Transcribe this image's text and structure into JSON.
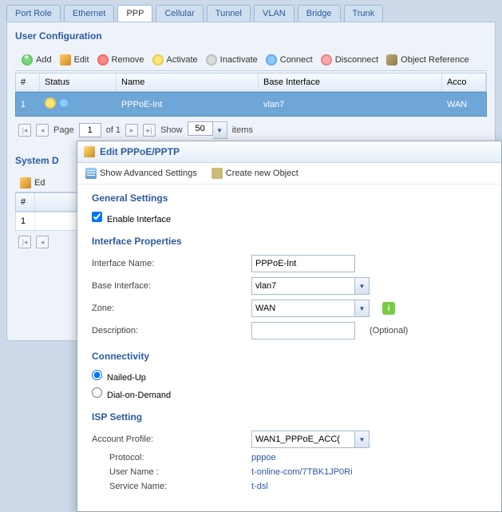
{
  "tabs": [
    "Port Role",
    "Ethernet",
    "PPP",
    "Cellular",
    "Tunnel",
    "VLAN",
    "Bridge",
    "Trunk"
  ],
  "active_tab": 2,
  "user_cfg_title": "User Configuration",
  "toolbar": {
    "add": "Add",
    "edit": "Edit",
    "remove": "Remove",
    "activate": "Activate",
    "inactivate": "Inactivate",
    "connect": "Connect",
    "disconnect": "Disconnect",
    "objref": "Object Reference"
  },
  "columns": {
    "num": "#",
    "status": "Status",
    "name": "Name",
    "base": "Base Interface",
    "acct": "Acco"
  },
  "row": {
    "num": "1",
    "name": "PPPoE-Int",
    "base": "vlan7",
    "acct": "WAN"
  },
  "pager": {
    "page_lbl": "Page",
    "page": "1",
    "of_lbl": "of 1",
    "show_lbl": "Show",
    "show": "50",
    "items_lbl": "items"
  },
  "sysd_title": "System D",
  "sysd_ed": "Ed",
  "sysd_num": "#",
  "sysd_row1": "1",
  "modal": {
    "title": "Edit PPPoE/PPTP",
    "adv": "Show Advanced Settings",
    "newobj": "Create new Object",
    "gen": "General Settings",
    "enable": "Enable Interface",
    "iprop": "Interface Properties",
    "ifname_lbl": "Interface Name:",
    "ifname": "PPPoE-Int",
    "baseif_lbl": "Base Interface:",
    "baseif": "vlan7",
    "zone_lbl": "Zone:",
    "zone": "WAN",
    "desc_lbl": "Description:",
    "desc": "",
    "optional": "(Optional)",
    "conn": "Connectivity",
    "nailed": "Nailed-Up",
    "dial": "Dial-on-Demand",
    "isp": "ISP Setting",
    "acct_lbl": "Account Profile:",
    "acct": "WAN1_PPPoE_ACC(",
    "proto_lbl": "Protocol:",
    "proto": "pppoe",
    "user_lbl": "User Name :",
    "user": "t-online-com/7TBK1JP0Ri",
    "svc_lbl": "Service Name:",
    "svc": "t-dsl"
  }
}
